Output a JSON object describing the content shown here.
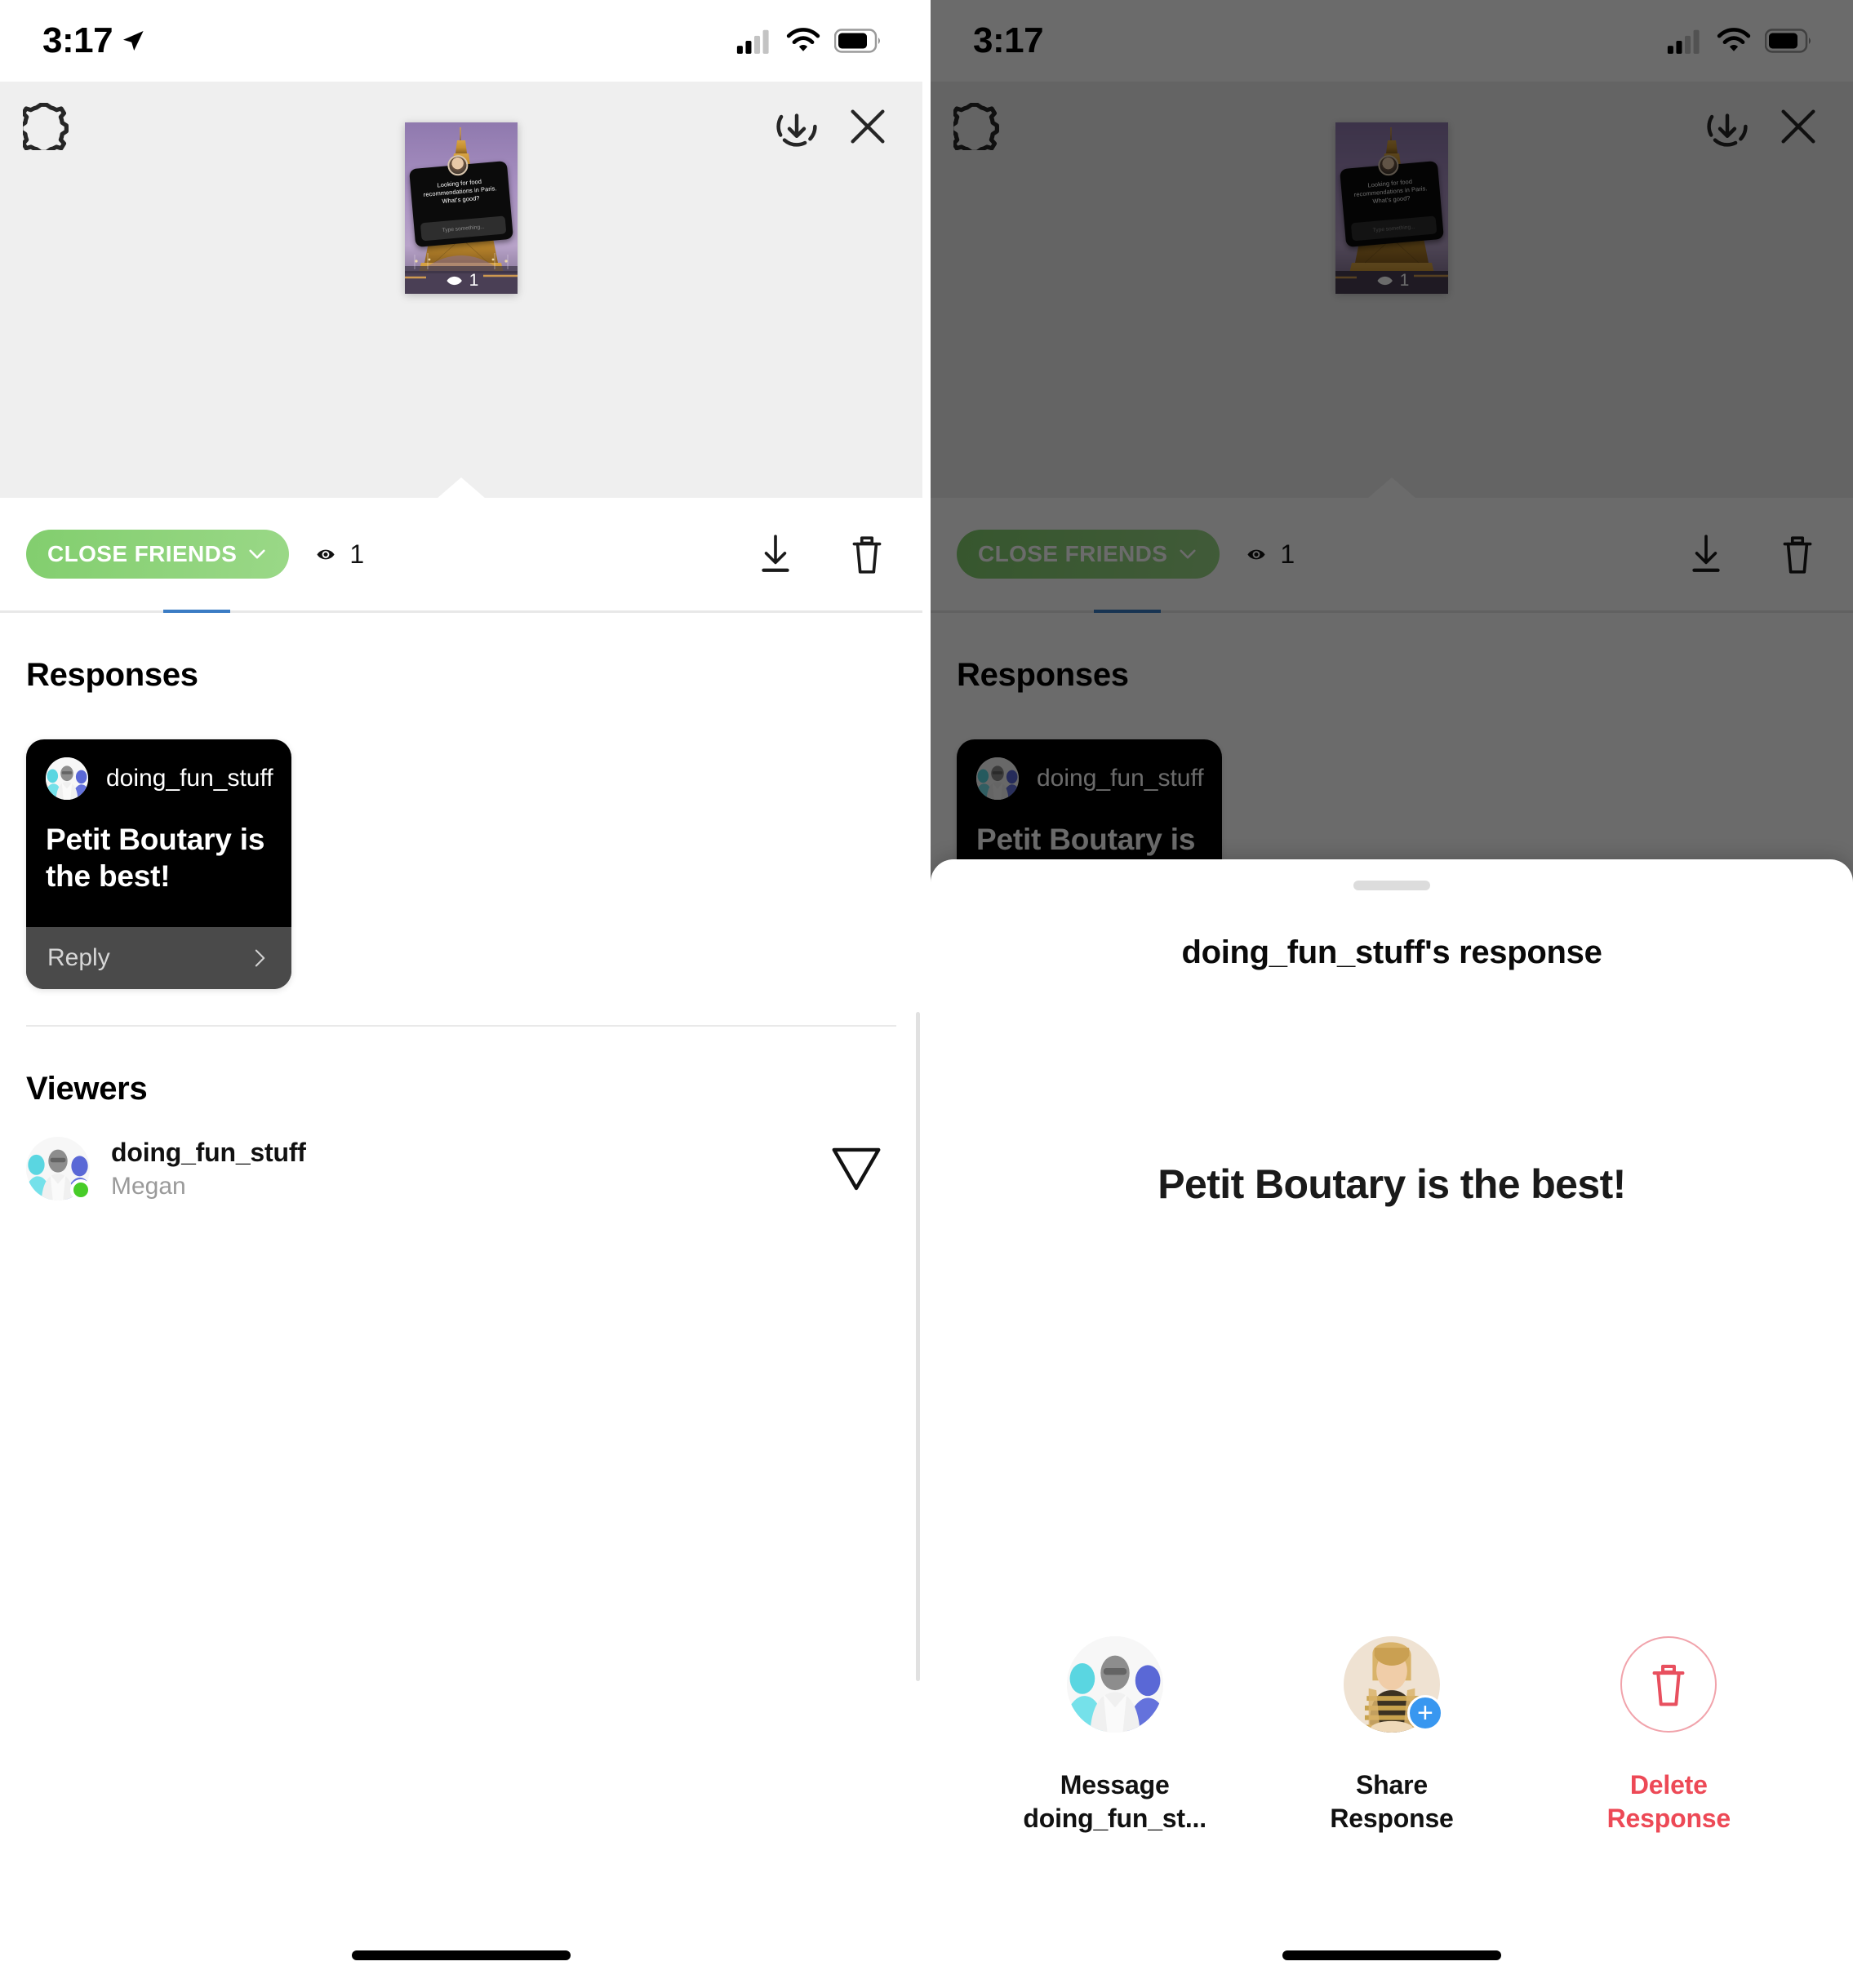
{
  "status_bar": {
    "time": "3:17",
    "location_icon": "location-arrow-icon",
    "cellular_icon": "cellular-signal-icon",
    "wifi_icon": "wifi-icon",
    "battery_icon": "battery-icon"
  },
  "header": {
    "settings_icon": "gear-icon",
    "archive_icon": "save-to-archive-icon",
    "close_icon": "close-x-icon"
  },
  "story": {
    "question_text": "Looking for food recommendations in Paris. What's good?",
    "input_placeholder": "Type something...",
    "view_count": "1",
    "eye_icon": "eye-icon"
  },
  "toolbar": {
    "audience_label": "CLOSE FRIENDS",
    "audience_chevron_icon": "chevron-down-icon",
    "eye_icon": "eye-icon",
    "view_count": "1",
    "download_icon": "download-icon",
    "delete_icon": "trash-icon"
  },
  "responses": {
    "title": "Responses",
    "items": [
      {
        "username": "doing_fun_stuff",
        "text": "Petit Boutary is the best!",
        "reply_label": "Reply",
        "reply_chevron_icon": "chevron-right-icon",
        "avatar": "user-avatar"
      }
    ]
  },
  "viewers": {
    "title": "Viewers",
    "items": [
      {
        "username": "doing_fun_stuff",
        "full_name": "Megan",
        "online": true,
        "send_icon": "send-message-icon",
        "avatar": "user-avatar"
      }
    ]
  },
  "sheet": {
    "title": "doing_fun_stuff's response",
    "response_text": "Petit Boutary is the best!",
    "grabber": "drag-handle",
    "actions": [
      {
        "label_line1": "Message",
        "label_line2": "doing_fun_st...",
        "icon": "user-avatar",
        "kind": "message"
      },
      {
        "label_line1": "Share",
        "label_line2": "Response",
        "icon": "your-story-avatar",
        "badge_icon": "plus-icon",
        "kind": "share"
      },
      {
        "label_line1": "Delete",
        "label_line2": "Response",
        "icon": "trash-icon",
        "kind": "delete"
      }
    ]
  },
  "colors": {
    "close_friends_green": "#8ad179",
    "online_green": "#47cc28",
    "delete_red": "#ed4956",
    "tab_blue": "#3b7cc4",
    "share_badge_blue": "#3897f0"
  }
}
